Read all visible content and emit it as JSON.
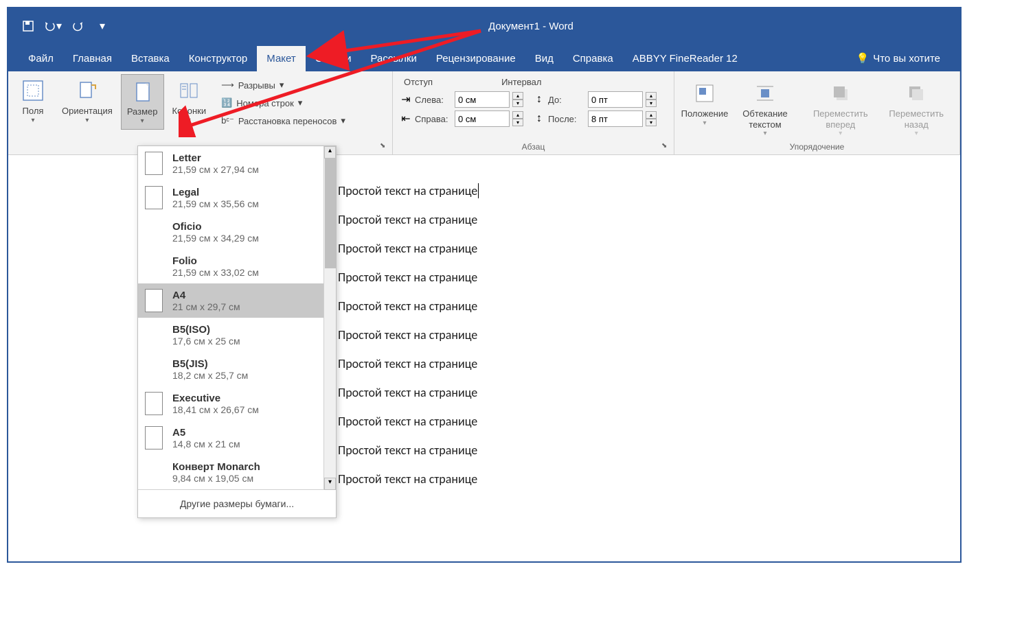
{
  "title": "Документ1  -  Word",
  "qat": {
    "save": "save-icon",
    "undo": "undo-icon",
    "redo": "redo-icon"
  },
  "tabs": [
    "Файл",
    "Главная",
    "Вставка",
    "Конструктор",
    "Макет",
    "Ссылки",
    "Рассылки",
    "Рецензирование",
    "Вид",
    "Справка",
    "ABBYY FineReader 12"
  ],
  "active_tab": "Макет",
  "tell_me": "Что вы хотите",
  "page_setup": {
    "margins": "Поля",
    "orientation": "Ориентация",
    "size": "Размер",
    "columns": "Колонки",
    "breaks": "Разрывы",
    "line_numbers": "Номера строк",
    "hyphenation": "Расстановка переносов"
  },
  "paragraph": {
    "group_label": "Абзац",
    "indent_label": "Отступ",
    "spacing_label": "Интервал",
    "left_label": "Слева:",
    "right_label": "Справа:",
    "before_label": "До:",
    "after_label": "После:",
    "left_value": "0 см",
    "right_value": "0 см",
    "before_value": "0 пт",
    "after_value": "8 пт"
  },
  "arrange": {
    "group_label": "Упорядочение",
    "position": "Положение",
    "wrap": "Обтекание текстом",
    "forward": "Переместить вперед",
    "backward": "Переместить назад"
  },
  "size_dropdown": {
    "items": [
      {
        "name": "Letter",
        "dim": "21,59 см x 27,94 см",
        "icon": true
      },
      {
        "name": "Legal",
        "dim": "21,59 см x 35,56 см",
        "icon": true
      },
      {
        "name": "Oficio",
        "dim": "21,59 см x 34,29 см",
        "icon": false
      },
      {
        "name": "Folio",
        "dim": "21,59 см x 33,02 см",
        "icon": false
      },
      {
        "name": "A4",
        "dim": "21 см x 29,7 см",
        "icon": true,
        "selected": true
      },
      {
        "name": "B5(ISO)",
        "dim": "17,6 см x 25 см",
        "icon": false
      },
      {
        "name": "B5(JIS)",
        "dim": "18,2 см x 25,7 см",
        "icon": false
      },
      {
        "name": "Executive",
        "dim": "18,41 см x 26,67 см",
        "icon": true
      },
      {
        "name": "A5",
        "dim": "14,8 см x 21 см",
        "icon": true
      },
      {
        "name": "Конверт Monarch",
        "dim": "9,84 см x 19,05 см",
        "icon": false
      }
    ],
    "more": "Другие размеры бумаги..."
  },
  "document_lines": [
    "Простой текст на странице",
    "Простой текст на странице",
    "Простой текст на странице",
    "Простой текст на странице",
    "Простой текст на странице",
    "Простой текст на странице",
    "Простой текст на странице",
    "Простой текст на странице",
    "Простой текст на странице",
    "Простой текст на странице",
    "Простой текст на странице"
  ]
}
